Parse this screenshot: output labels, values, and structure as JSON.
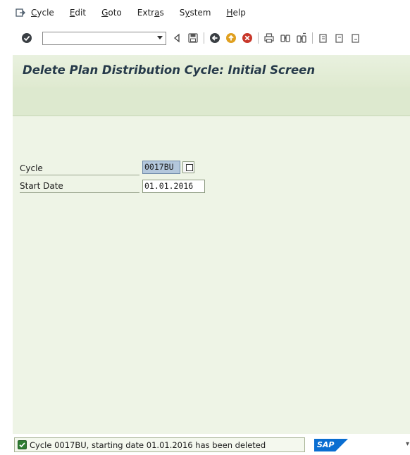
{
  "menu": {
    "items": [
      {
        "label": "Cycle",
        "mnemonic": "C"
      },
      {
        "label": "Edit",
        "mnemonic": "E"
      },
      {
        "label": "Goto",
        "mnemonic": "G"
      },
      {
        "label": "Extras",
        "mnemonic": "a"
      },
      {
        "label": "System",
        "mnemonic": "y"
      },
      {
        "label": "Help",
        "mnemonic": "H"
      }
    ]
  },
  "toolbar": {
    "command_value": "",
    "icons": [
      "enter-icon",
      "back-triangle-icon",
      "save-icon",
      "back-icon",
      "exit-icon",
      "cancel-icon",
      "print-icon",
      "find-icon",
      "find-next-icon",
      "first-page-icon",
      "prev-page-icon",
      "next-page-icon"
    ]
  },
  "screen": {
    "title": "Delete Plan Distribution Cycle: Initial Screen"
  },
  "fields": {
    "cycle": {
      "label": "Cycle",
      "value": "0017BU"
    },
    "start_date": {
      "label": "Start Date",
      "value": "01.01.2016"
    }
  },
  "status": {
    "message": "Cycle 0017BU, starting date 01.01.2016 has been deleted",
    "type": "success",
    "logo": "SAP"
  },
  "colors": {
    "work_area": "#eef4e6",
    "app_bar": "#dde9cf",
    "title_text": "#263a4a",
    "selected_field": "#b3c7dc"
  }
}
